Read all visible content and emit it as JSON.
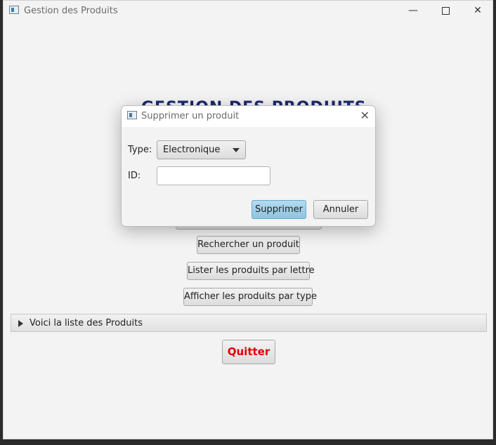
{
  "window": {
    "title": "Gestion des Produits"
  },
  "main": {
    "heading": "GESTION DES PRODUITS",
    "buttons": {
      "rechercher": "Rechercher un produit",
      "lister": "Lister les produits par lettre",
      "afficher": "Afficher les produits par type"
    },
    "accordion_label": "Voici la liste des Produits",
    "quit_label": "Quitter"
  },
  "dialog": {
    "title": "Supprimer un produit",
    "type_label": "Type:",
    "type_value": "Electronique",
    "id_label": "ID:",
    "id_value": "",
    "submit_label": "Supprimer",
    "cancel_label": "Annuler"
  },
  "colors": {
    "heading": "#1a2a6e",
    "quit_text": "#e00000",
    "primary_button": "#9fcfe8"
  }
}
